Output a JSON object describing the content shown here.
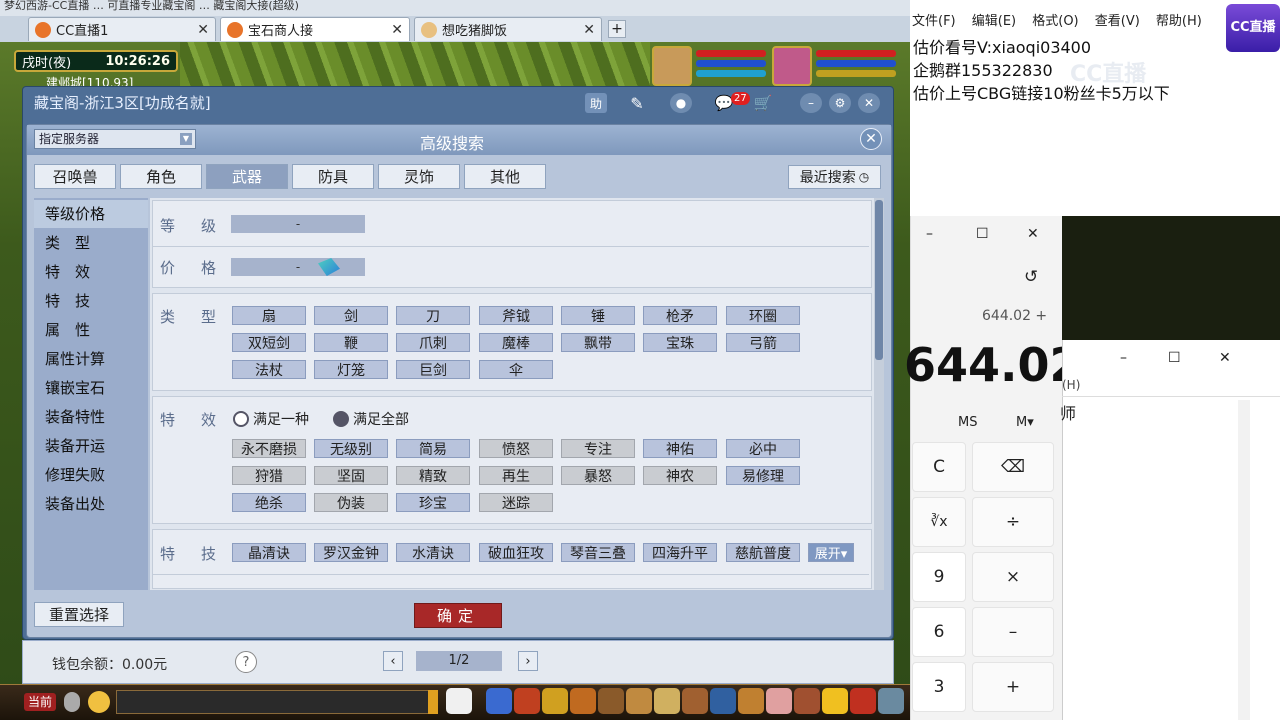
{
  "browser": {
    "strip_text": "梦幻西游-CC直播 … 可直播专业藏宝阁 … 藏宝阁大接(超级)",
    "tabs": [
      {
        "label": "CC直播1"
      },
      {
        "label": "宝石商人接",
        "active": true
      },
      {
        "label": "想吃猪脚饭"
      }
    ],
    "new_tab": "+"
  },
  "game": {
    "time_label": "戌时(夜)",
    "clock": "10:26:26",
    "location": "建邺城[110,93]"
  },
  "window": {
    "title": "藏宝阁-浙江3区[功成名就]",
    "help": "助",
    "mail_count": "27",
    "minimize": "–",
    "settings": "⚙",
    "close": "✕"
  },
  "dialog": {
    "title": "高级搜索",
    "server": "指定服务器",
    "close": "✕",
    "categories": [
      "召唤兽",
      "角色",
      "武器",
      "防具",
      "灵饰",
      "其他"
    ],
    "active_category": "武器",
    "recent": "最近搜索",
    "nav": [
      "等级价格",
      "类　型",
      "特　效",
      "特　技",
      "属　性",
      "属性计算",
      "镶嵌宝石",
      "装备特性",
      "装备开运",
      "修理失败",
      "装备出处"
    ],
    "level_label": "等级",
    "level_range": "-",
    "price_label": "价格",
    "price_range": "-",
    "type_label": "类型",
    "types": [
      "扇",
      "剑",
      "刀",
      "斧钺",
      "锤",
      "枪矛",
      "环圈",
      "双短剑",
      "鞭",
      "爪刺",
      "魔棒",
      "飘带",
      "宝珠",
      "弓箭",
      "法杖",
      "灯笼",
      "巨剑",
      "伞"
    ],
    "effect_label": "特效",
    "radio_any": "满足一种",
    "radio_all": "满足全部",
    "effects": [
      "永不磨损",
      "无级别",
      "简易",
      "愤怒",
      "专注",
      "神佑",
      "必中",
      "狩猎",
      "坚固",
      "精致",
      "再生",
      "暴怒",
      "神农",
      "易修理",
      "绝杀",
      "伪装",
      "珍宝",
      "迷踪"
    ],
    "skill_label": "特技",
    "skills": [
      "晶清诀",
      "罗汉金钟",
      "水清诀",
      "破血狂攻",
      "琴音三叠",
      "四海升平",
      "慈航普度"
    ],
    "expand": "展开▾",
    "reset": "重置选择",
    "confirm": "确定"
  },
  "footer": {
    "wallet": "钱包余额：0.00元",
    "help": "?",
    "prev": "‹",
    "page": "1/2",
    "next": "›"
  },
  "bottom": {
    "current": "当前"
  },
  "notepad": {
    "menu": "文件(F) 编辑(E) 格式(O) 查看(V) 帮助(H)",
    "text": "估价看号V:xiaoqi03400\n企鹅群155322830\n估价上号CBG链接10粉丝卡5万以下",
    "logo": "CC直播",
    "watermark": "CC直播"
  },
  "calc": {
    "min": "–",
    "max": "☐",
    "close": "✕",
    "history": "↺",
    "expr": "644.02 +",
    "result": "644.02",
    "ms": "MS",
    "mm": "M▾",
    "keys": [
      "C",
      "⌫",
      "∛x",
      "÷",
      "9",
      "×",
      "6",
      "–",
      "3",
      "+"
    ]
  },
  "notepad2": {
    "min": "–",
    "max": "☐",
    "close": "✕",
    "menu": "(H)",
    "text": "师"
  },
  "colors": {
    "accent_red": "#a82828",
    "dialog_bg": "#b7c5da",
    "window_bg": "#4e6e96"
  }
}
